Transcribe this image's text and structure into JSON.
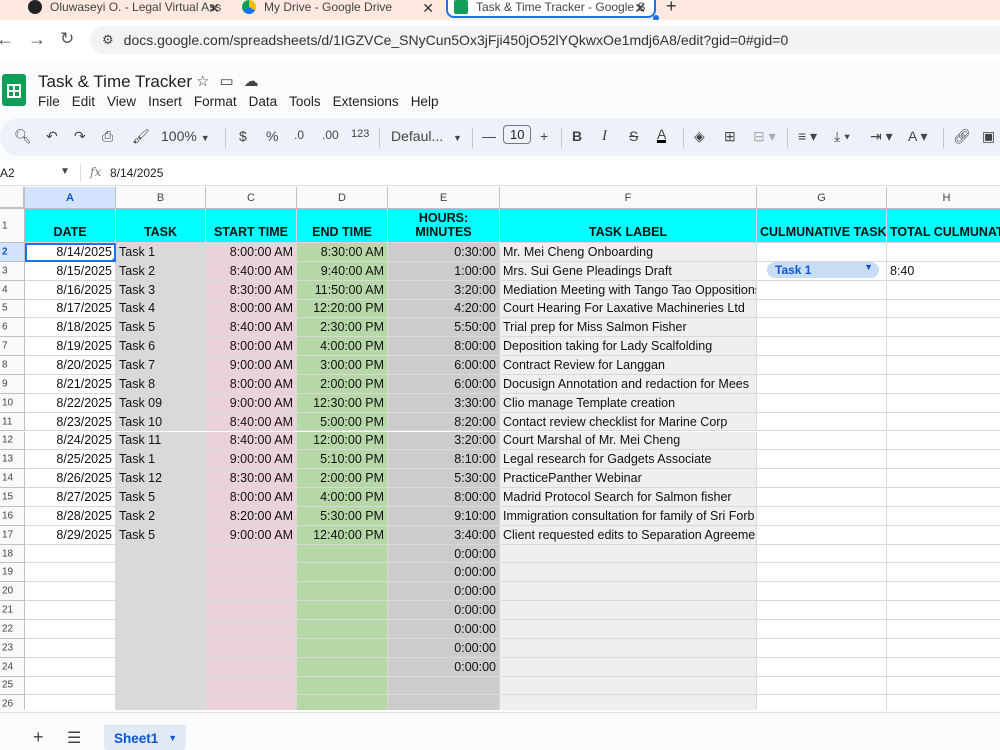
{
  "browser": {
    "tabs": [
      {
        "title": "Oluwaseyi O. - Legal Virtual Ass",
        "active": false
      },
      {
        "title": "My Drive - Google Drive",
        "active": false
      },
      {
        "title": "Task & Time Tracker - Google S",
        "active": true
      }
    ],
    "url": "docs.google.com/spreadsheets/d/1IGZVCe_SNyCun5Ox3jFji450jO52lYQkwxOe1mdj6A8/edit?gid=0#gid=0"
  },
  "doc": {
    "title": "Task & Time Tracker",
    "menus": [
      "File",
      "Edit",
      "View",
      "Insert",
      "Format",
      "Data",
      "Tools",
      "Extensions",
      "Help"
    ]
  },
  "toolbar": {
    "zoom": "100%",
    "currency": "$",
    "percent": "%",
    "dec_decrease": ".0",
    "dec_increase": ".00",
    "number_format": "123",
    "font": "Defaul...",
    "font_size": "10",
    "bold": "B",
    "italic": "I",
    "strike": "S",
    "text_color": "A",
    "font_color": "A"
  },
  "formula_bar": {
    "name_box": "A2",
    "fx": "fx",
    "value": "8/14/2025"
  },
  "columns": [
    "A",
    "B",
    "C",
    "D",
    "E",
    "F",
    "G",
    "H"
  ],
  "headers": [
    "DATE",
    "TASK",
    "START TIME",
    "END TIME",
    "DURATION HOURS: MINUTES",
    "TASK LABEL",
    "CULMUNATIVE TASK",
    "TOTAL CULMUNAT"
  ],
  "rows": [
    [
      "8/14/2025",
      "Task 1",
      "8:00:00 AM",
      "8:30:00 AM",
      "0:30:00",
      "Mr. Mei Cheng Onboarding"
    ],
    [
      "8/15/2025",
      "Task 2",
      "8:40:00 AM",
      "9:40:00 AM",
      "1:00:00",
      "Mrs. Sui Gene Pleadings Draft"
    ],
    [
      "8/16/2025",
      "Task 3",
      "8:30:00 AM",
      "11:50:00 AM",
      "3:20:00",
      "Mediation Meeting with Tango Tao Oppositions"
    ],
    [
      "8/17/2025",
      "Task 4",
      "8:00:00 AM",
      "12:20:00 PM",
      "4:20:00",
      "Court Hearing For Laxative Machineries Ltd"
    ],
    [
      "8/18/2025",
      "Task 5",
      "8:40:00 AM",
      "2:30:00 PM",
      "5:50:00",
      "Trial prep for Miss Salmon Fisher"
    ],
    [
      "8/19/2025",
      "Task 6",
      "8:00:00 AM",
      "4:00:00 PM",
      "8:00:00",
      "Deposition taking for Lady Scalfolding"
    ],
    [
      "8/20/2025",
      "Task  7",
      "9:00:00 AM",
      "3:00:00 PM",
      "6:00:00",
      "Contract Review for Langgan"
    ],
    [
      "8/21/2025",
      "Task 8",
      "8:00:00 AM",
      "2:00:00 PM",
      "6:00:00",
      "Docusign Annotation and redaction for Mees"
    ],
    [
      "8/22/2025",
      "Task 09",
      "9:00:00 AM",
      "12:30:00 PM",
      "3:30:00",
      "Clio manage Template creation"
    ],
    [
      "8/23/2025",
      "Task 10",
      "8:40:00 AM",
      "5:00:00 PM",
      "8:20:00",
      "Contact review checklist for Marine Corp"
    ],
    [
      "8/24/2025",
      "Task 11",
      "8:40:00 AM",
      "12:00:00 PM",
      "3:20:00",
      "Court Marshal of  Mr. Mei Cheng"
    ],
    [
      "8/25/2025",
      "Task 1",
      "9:00:00 AM",
      "5:10:00 PM",
      "8:10:00",
      "Legal research for Gadgets Associate"
    ],
    [
      "8/26/2025",
      "Task 12",
      "8:30:00 AM",
      "2:00:00 PM",
      "5:30:00",
      "PracticePanther Webinar"
    ],
    [
      "8/27/2025",
      "Task 5",
      "8:00:00 AM",
      "4:00:00 PM",
      "8:00:00",
      "Madrid Protocol Search for Salmon fisher"
    ],
    [
      "8/28/2025",
      "Task 2",
      "8:20:00 AM",
      "5:30:00 PM",
      "9:10:00",
      "Immigration consultation for family of Sri Forb"
    ],
    [
      "8/29/2025",
      "Task 5",
      "9:00:00 AM",
      "12:40:00 PM",
      "3:40:00",
      "Client requested edits to Separation Agreement"
    ],
    [
      "",
      "",
      "",
      "",
      "0:00:00",
      ""
    ],
    [
      "",
      "",
      "",
      "",
      "0:00:00",
      ""
    ],
    [
      "",
      "",
      "",
      "",
      "0:00:00",
      ""
    ],
    [
      "",
      "",
      "",
      "",
      "0:00:00",
      ""
    ],
    [
      "",
      "",
      "",
      "",
      "0:00:00",
      ""
    ],
    [
      "",
      "",
      "",
      "",
      "0:00:00",
      ""
    ],
    [
      "",
      "",
      "",
      "",
      "0:00:00",
      ""
    ],
    [
      "",
      "",
      "",
      "",
      "",
      ""
    ],
    [
      "",
      "",
      "",
      "",
      "",
      ""
    ]
  ],
  "row_numbers": [
    "1",
    "2",
    "3",
    "4",
    "5",
    "6",
    "7",
    "8",
    "9",
    "10",
    "11",
    "12",
    "13",
    "14",
    "15",
    "16",
    "17",
    "18",
    "19",
    "20",
    "21",
    "22",
    "23",
    "24",
    "25",
    "26"
  ],
  "culmunative": {
    "selected_task": "Task 1",
    "total": "8:40"
  },
  "colors": {
    "header_fill": "#00ffff",
    "task_col": "#d9d9d9",
    "start_col": "#ead1dc",
    "end_col": "#b6d7a8",
    "duration_col": "#cccccc",
    "label_col": "#efefef"
  },
  "sheet": {
    "name": "Sheet1"
  }
}
